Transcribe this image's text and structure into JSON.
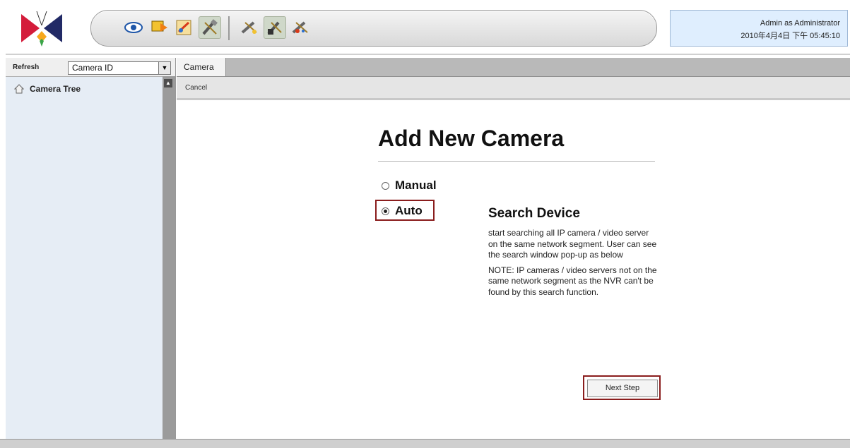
{
  "header": {
    "user_line1": "Admin as Administrator",
    "user_line2": "2010年4月4日 下午 05:45:10",
    "toolbar_icons": [
      "live-view-icon",
      "playback-icon",
      "search-icon",
      "setup-icon",
      "settings-tools-icon",
      "config-tools-icon",
      "advanced-tools-icon"
    ]
  },
  "left_panel": {
    "refresh_label": "Refresh",
    "select_value": "Camera ID",
    "tree_root_label": "Camera Tree"
  },
  "tabs": [
    {
      "label": "Camera"
    }
  ],
  "subbar": {
    "cancel_label": "Cancel"
  },
  "main": {
    "title": "Add New Camera",
    "options": [
      {
        "label": "Manual",
        "checked": false
      },
      {
        "label": "Auto",
        "checked": true
      }
    ],
    "description_title": "Search Device",
    "description": "start searching all IP camera / video server on the same network segment. User can see the search window pop-up as below",
    "note": "NOTE: IP cameras / video servers not on the same network segment as the NVR can't be found by this search function.",
    "next_button": "Next Step"
  },
  "colors": {
    "accent_border": "#8a1d1d",
    "left_panel_bg": "#e6edf5",
    "userbox_bg": "#dfeefe"
  }
}
